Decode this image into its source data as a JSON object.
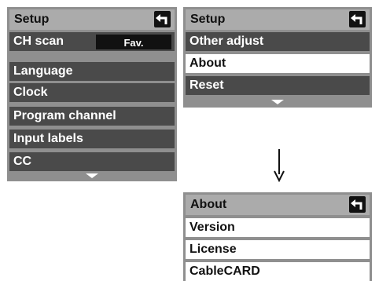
{
  "left_panel": {
    "title": "Setup",
    "ch_scan": {
      "label": "CH scan",
      "value": "Fav."
    },
    "items": [
      {
        "label": "Language"
      },
      {
        "label": "Clock"
      },
      {
        "label": "Program channel"
      },
      {
        "label": "Input labels"
      },
      {
        "label": "CC"
      }
    ]
  },
  "right_panel": {
    "title": "Setup",
    "items": [
      {
        "label": "Other adjust"
      },
      {
        "label": "About",
        "selected": true
      },
      {
        "label": "Reset"
      }
    ]
  },
  "about_panel": {
    "title": "About",
    "items": [
      {
        "label": "Version"
      },
      {
        "label": "License"
      },
      {
        "label": "CableCARD"
      }
    ]
  },
  "icons": {
    "back": "return-arrow-icon",
    "scroll": "chevron-down-icon",
    "flow": "arrow-down-icon"
  },
  "colors": {
    "panel_bg": "#8f8f8f",
    "title_bg": "#ababab",
    "item_bg": "#4a4a4a",
    "selected_bg": "#ffffff"
  }
}
